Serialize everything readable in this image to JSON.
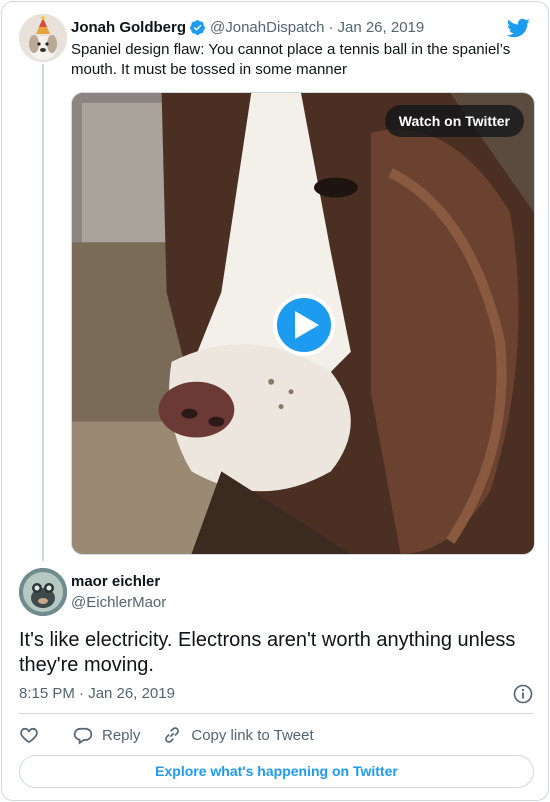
{
  "parent_tweet": {
    "author_name": "Jonah Goldberg",
    "handle": "@JonahDispatch",
    "separator": "·",
    "date": "Jan 26, 2019",
    "text": "Spaniel design flaw: You cannot place a tennis ball in the spaniel’s mouth. It must be tossed in some manner",
    "media": {
      "watch_label": "Watch on Twitter",
      "icon": "play-icon"
    }
  },
  "reply_tweet": {
    "author_name": "maor eichler",
    "handle": "@EichlerMaor",
    "text": "It's like electricity. Electrons aren't worth anything unless they're moving.",
    "timestamp": "8:15 PM · Jan 26, 2019"
  },
  "actions": {
    "reply_label": "Reply",
    "copy_label": "Copy link to Tweet"
  },
  "footer": {
    "explore_label": "Explore what's happening on Twitter"
  },
  "colors": {
    "accent": "#1d9bf0",
    "text": "#0f1419",
    "muted": "#536471",
    "border": "#cfd9de"
  }
}
